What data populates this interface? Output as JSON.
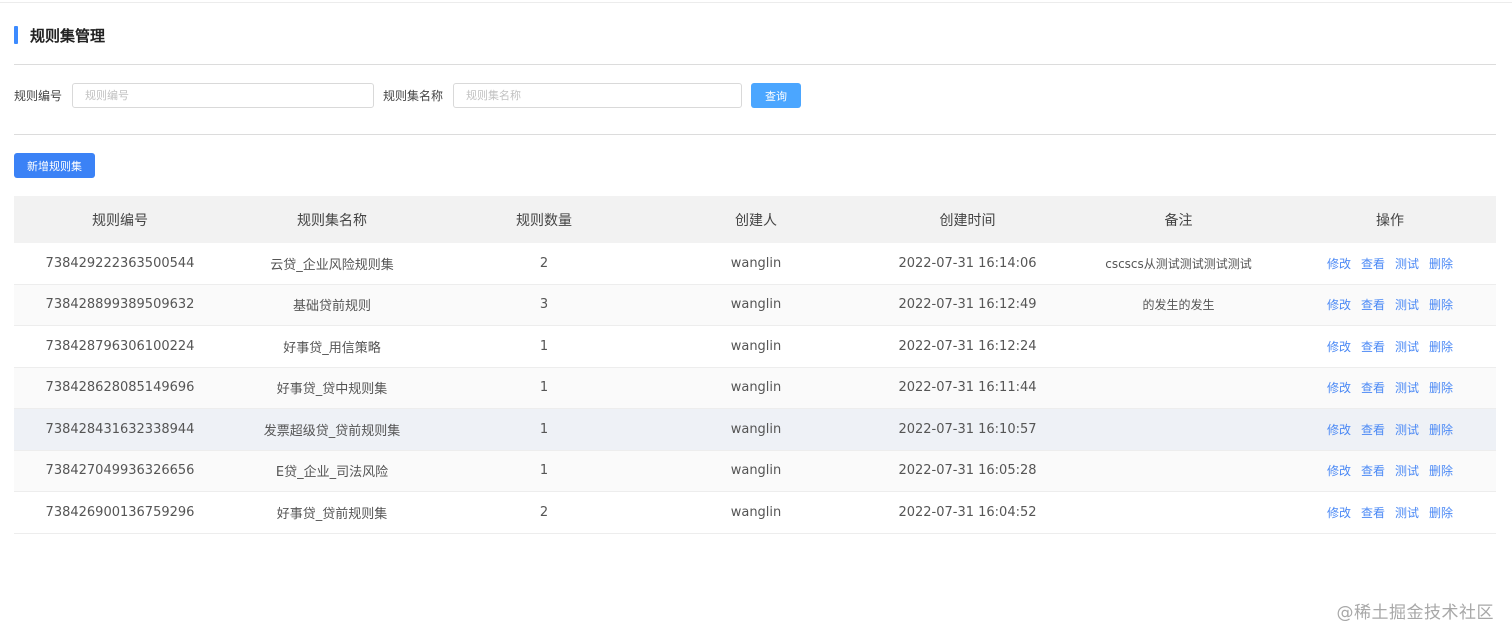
{
  "header": {
    "title": "规则集管理"
  },
  "filters": {
    "rule_id_label": "规则编号",
    "rule_id_placeholder": "规则编号",
    "ruleset_name_label": "规则集名称",
    "ruleset_name_placeholder": "规则集名称",
    "query_label": "查询"
  },
  "toolbar": {
    "add_label": "新增规则集"
  },
  "table": {
    "columns": [
      "规则编号",
      "规则集名称",
      "规则数量",
      "创建人",
      "创建时间",
      "备注",
      "操作"
    ],
    "actions": [
      "修改",
      "查看",
      "测试",
      "删除"
    ],
    "rows": [
      {
        "id": "738429222363500544",
        "name": "云贷_企业风险规则集",
        "count": "2",
        "creator": "wanglin",
        "created": "2022-07-31 16:14:06",
        "remark": "cscscs从测试测试测试测试"
      },
      {
        "id": "738428899389509632",
        "name": "基础贷前规则",
        "count": "3",
        "creator": "wanglin",
        "created": "2022-07-31 16:12:49",
        "remark": "的发生的发生"
      },
      {
        "id": "738428796306100224",
        "name": "好事贷_用信策略",
        "count": "1",
        "creator": "wanglin",
        "created": "2022-07-31 16:12:24",
        "remark": ""
      },
      {
        "id": "738428628085149696",
        "name": "好事贷_贷中规则集",
        "count": "1",
        "creator": "wanglin",
        "created": "2022-07-31 16:11:44",
        "remark": ""
      },
      {
        "id": "738428431632338944",
        "name": "发票超级贷_贷前规则集",
        "count": "1",
        "creator": "wanglin",
        "created": "2022-07-31 16:10:57",
        "remark": ""
      },
      {
        "id": "738427049936326656",
        "name": "E贷_企业_司法风险",
        "count": "1",
        "creator": "wanglin",
        "created": "2022-07-31 16:05:28",
        "remark": ""
      },
      {
        "id": "738426900136759296",
        "name": "好事贷_贷前规则集",
        "count": "2",
        "creator": "wanglin",
        "created": "2022-07-31 16:04:52",
        "remark": ""
      }
    ]
  },
  "watermark": "@稀土掘金技术社区",
  "colors": {
    "accent": "#3d8bff",
    "link": "#4b89f5",
    "query_button": "#4ba6ff",
    "add_button": "#3b82f6"
  }
}
